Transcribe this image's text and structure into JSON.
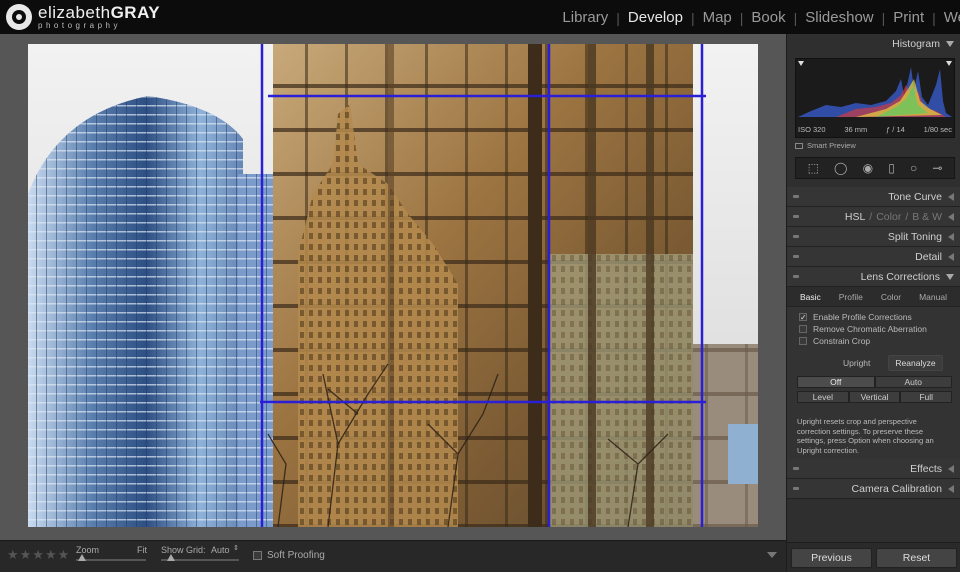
{
  "logo": {
    "name_light": "elizabeth",
    "name_bold": "GRAY",
    "subtitle": "photography"
  },
  "modules": [
    {
      "label": "Library"
    },
    {
      "label": "Develop"
    },
    {
      "label": "Map"
    },
    {
      "label": "Book"
    },
    {
      "label": "Slideshow"
    },
    {
      "label": "Print"
    },
    {
      "label": "We"
    }
  ],
  "toolbar": {
    "stars": "★★★★★",
    "zoom_label": "Zoom",
    "zoom_value": "Fit",
    "grid_label": "Show Grid:",
    "grid_value": "Auto",
    "soft_proofing": "Soft Proofing"
  },
  "histogram": {
    "title": "Histogram",
    "iso": "ISO 320",
    "focal": "36 mm",
    "aperture": "ƒ / 14",
    "shutter": "1/80 sec",
    "smart_preview": "Smart Preview"
  },
  "panels": {
    "tone_curve": "Tone Curve",
    "hsl": "HSL",
    "color": "Color",
    "bw": "B & W",
    "split_toning": "Split Toning",
    "detail": "Detail",
    "lens_corrections": "Lens Corrections",
    "effects": "Effects",
    "camera_calibration": "Camera Calibration"
  },
  "lens": {
    "tabs": [
      {
        "label": "Basic"
      },
      {
        "label": "Profile"
      },
      {
        "label": "Color"
      },
      {
        "label": "Manual"
      }
    ],
    "enable_profile": "Enable Profile Corrections",
    "remove_ca": "Remove Chromatic Aberration",
    "constrain_crop": "Constrain Crop",
    "upright_label": "Upright",
    "reanalyze": "Reanalyze",
    "btn_off": "Off",
    "btn_auto": "Auto",
    "btn_level": "Level",
    "btn_vertical": "Vertical",
    "btn_full": "Full",
    "note": "Upright resets crop and perspective correction settings. To preserve these settings, press Option when choosing an Upright correction."
  },
  "buttons": {
    "previous": "Previous",
    "reset": "Reset"
  },
  "colors": {
    "guide_lines": "#2a1fd6",
    "accent": "#cfcfcf"
  }
}
